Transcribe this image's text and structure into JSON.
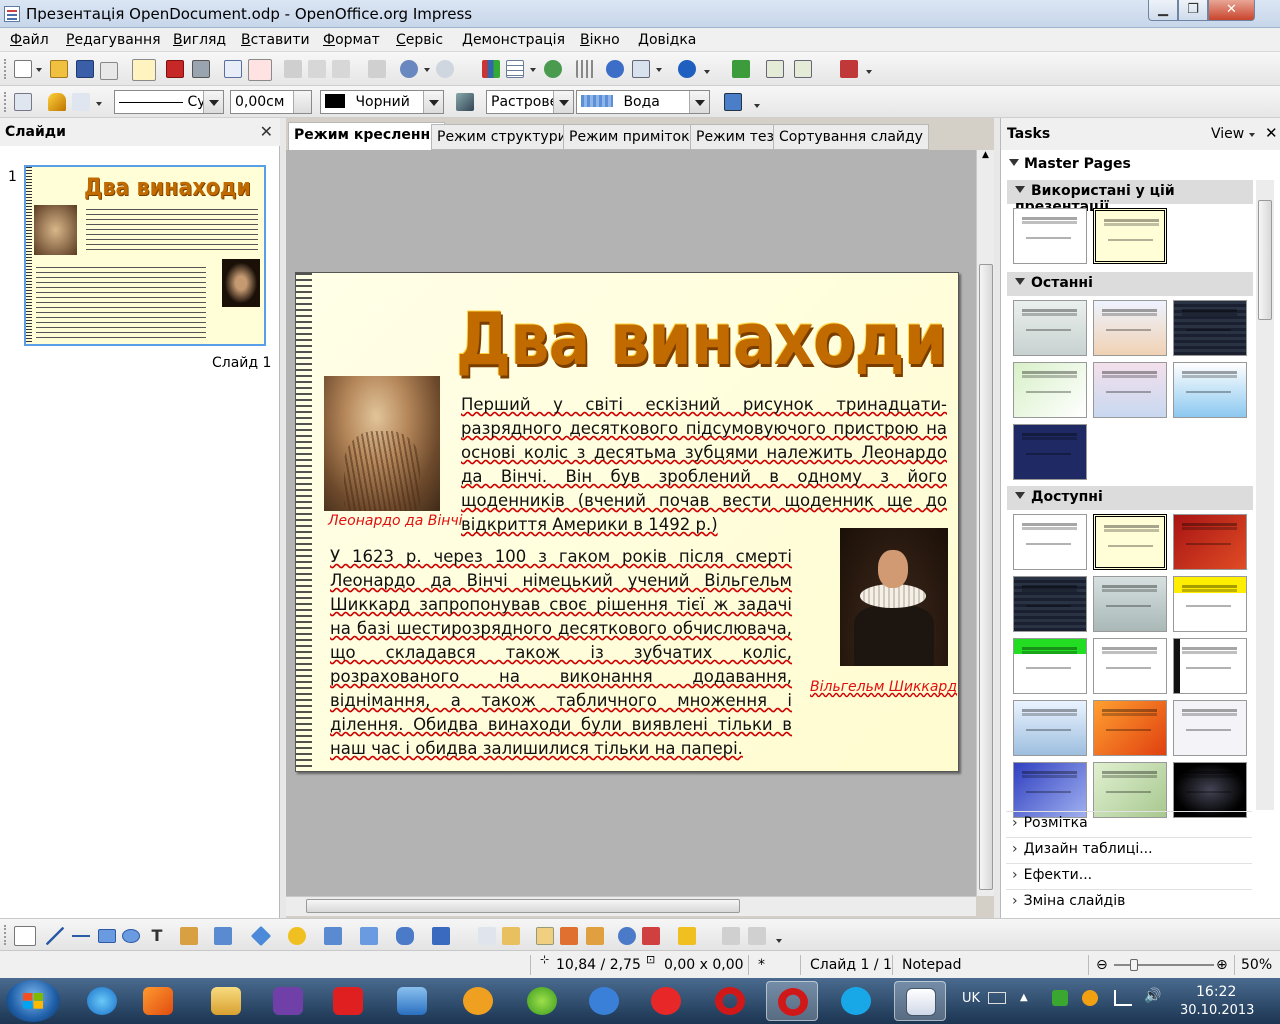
{
  "window": {
    "title": "Презентація OpenDocument.odp - OpenOffice.org Impress",
    "min_glyph": "▁",
    "max_glyph": "❐",
    "close_glyph": "✕"
  },
  "menu": [
    "Файл",
    "Редагування",
    "Вигляд",
    "Вставити",
    "Формат",
    "Сервіс",
    "Демонстрація",
    "Вікно",
    "Довідка"
  ],
  "line_toolbar": {
    "line_style_value": "Су",
    "line_width_value": "0,00см",
    "line_color_value": "Чорний",
    "area_style_value": "Растрове",
    "area_fill_value": "Вода"
  },
  "slides_pane": {
    "title": "Слайди",
    "close_glyph": "✕",
    "slide_number": "1",
    "slide_caption": "Слайд 1"
  },
  "view_tabs": [
    "Режим креслення",
    "Режим структури",
    "Режим приміток",
    "Режим тез",
    "Сортування слайду"
  ],
  "slide": {
    "title": "Два винаходи",
    "paragraph1": "Перший у світі ескізний рисунок тринадцати-разрядного десяткового підсумовуючого пристрою на основі коліс з десятьма зубцями належить Леонардо да Вінчі. Він був зроблений в одному з його щоденників (вчений почав вести щоденник ще до відкриття Америки в 1492 р.)",
    "caption_leonardo": "Леонардо да Вінчі",
    "paragraph2": "У 1623 р. через 100 з гаком років після смерті Леонардо да Вінчі німецький учений Вільгельм Шиккард запропонував своє рішення тієї ж задачі на базі шестирозрядного десяткового обчислювача, що складався також із зубчатих коліс, розрахованого на виконання додавання, віднімання, а також табличного множення і ділення. Обидва винаходи були виявлені тільки в наш час і обидва залишилися тільки на папері.",
    "caption_schickard": "Вільгельм Шиккард"
  },
  "tasks_pane": {
    "title": "Tasks",
    "view_label": "View",
    "close_glyph": "✕",
    "master_pages_label": "Master Pages",
    "sections": {
      "used": "Використані у цій презентації",
      "recent": "Останні",
      "available": "Доступні"
    },
    "links": [
      "Розмітка",
      "Дизайн таблиці...",
      "Ефекти...",
      "Зміна слайдів"
    ]
  },
  "statusbar": {
    "position": "10,84 / 2,75",
    "size": "0,00 x 0,00",
    "modified": "*",
    "slide": "Слайд 1 / 1",
    "master": "Notepad",
    "zoom": "50%"
  },
  "taskbar": {
    "lang": "UK",
    "time": "16:22",
    "date": "30.10.2013"
  },
  "colors": {
    "title_gradient_orange": "#c06a00",
    "caption_red": "#e01010",
    "slide_bg": "#fffed6",
    "selection_blue": "#5a9ee8"
  }
}
